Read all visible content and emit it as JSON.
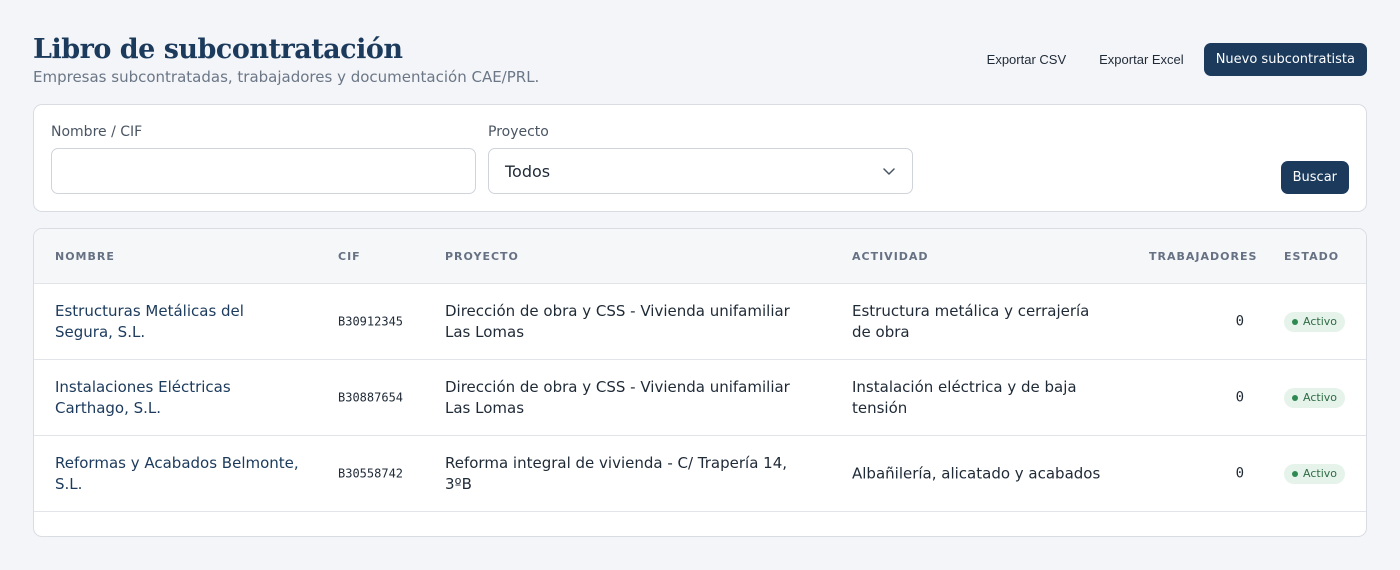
{
  "header": {
    "title": "Libro de subcontratación",
    "subtitle": "Empresas subcontratadas, trabajadores y documentación CAE/PRL."
  },
  "actions": {
    "export_csv": "Exportar CSV",
    "export_excel": "Exportar Excel",
    "new_subcontractor": "Nuevo subcontratista"
  },
  "filters": {
    "name_label": "Nombre / CIF",
    "name_value": "",
    "project_label": "Proyecto",
    "project_value": "Todos",
    "search_button": "Buscar"
  },
  "table": {
    "columns": [
      "NOMBRE",
      "CIF",
      "PROYECTO",
      "ACTIVIDAD",
      "TRABAJADORES",
      "ESTADO"
    ],
    "rows": [
      {
        "nombre": "Estructuras Metálicas del Segura, S.L.",
        "cif": "B30912345",
        "proyecto": "Dirección de obra y CSS - Vivienda unifamiliar Las Lomas",
        "actividad": "Estructura metálica y cerrajería de obra",
        "trabajadores": "0",
        "estado": "Activo"
      },
      {
        "nombre": "Instalaciones Eléctricas Carthago, S.L.",
        "cif": "B30887654",
        "proyecto": "Dirección de obra y CSS - Vivienda unifamiliar Las Lomas",
        "actividad": "Instalación eléctrica y de baja tensión",
        "trabajadores": "0",
        "estado": "Activo"
      },
      {
        "nombre": "Reformas y Acabados Belmonte, S.L.",
        "cif": "B30558742",
        "proyecto": "Reforma integral de vivienda - C/ Trapería 14, 3ºB",
        "actividad": "Albañilería, alicatado y acabados",
        "trabajadores": "0",
        "estado": "Activo"
      }
    ]
  },
  "colors": {
    "primary": "#1b3a5c",
    "background": "#f4f5f8",
    "badge_bg": "#e5f3ea",
    "badge_text": "#2f6b45"
  },
  "icons": {
    "select_arrow": "chevron-down-icon",
    "status": "status-dot-icon"
  }
}
